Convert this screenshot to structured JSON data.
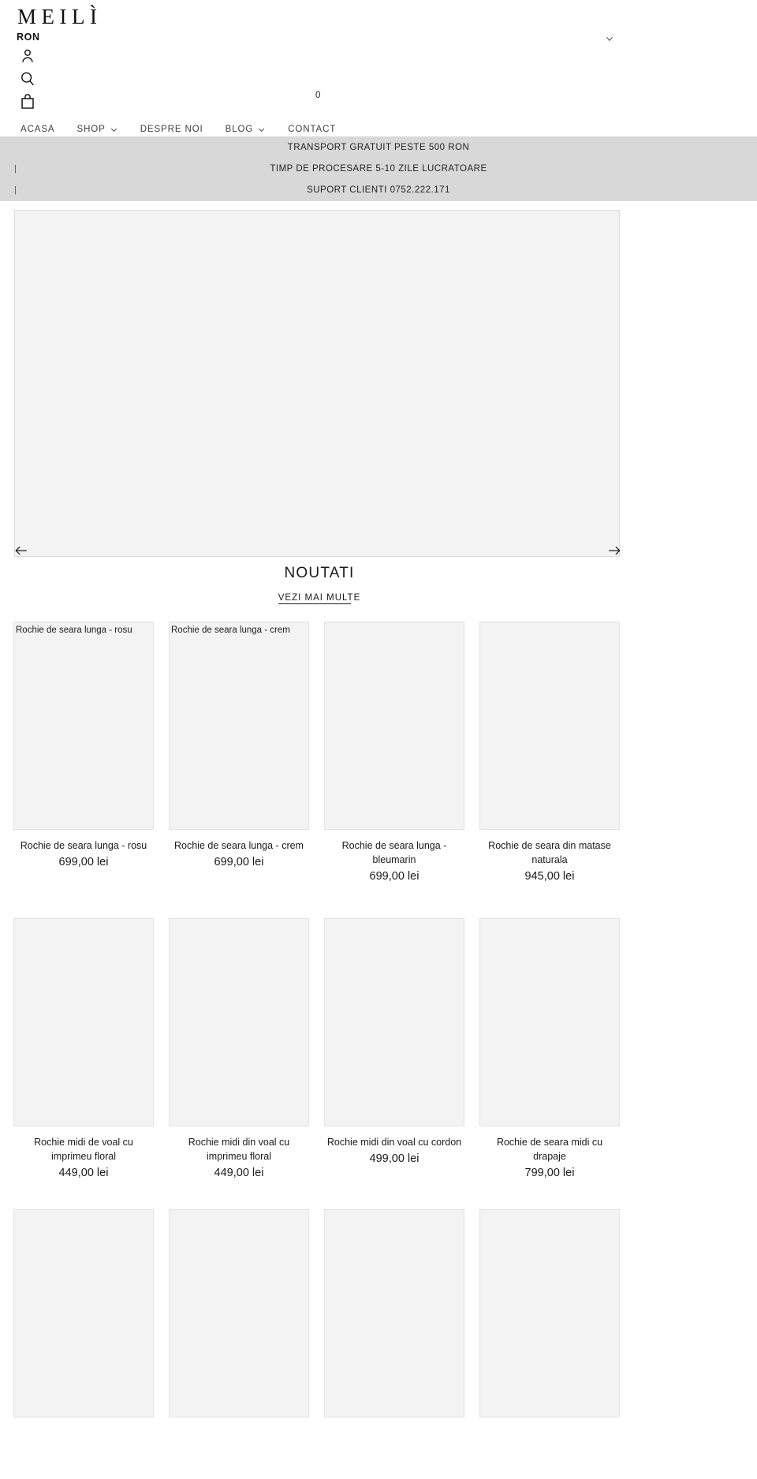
{
  "header": {
    "logo": "MEILÌ",
    "currency": "RON",
    "cart_count": "0",
    "icons": {
      "account": "account-icon",
      "search": "search-icon",
      "bag": "shopping-bag-icon",
      "currency_chevron": "chevron-down-icon"
    }
  },
  "nav": {
    "items": [
      {
        "label": "ACASA",
        "has_dropdown": false
      },
      {
        "label": "SHOP",
        "has_dropdown": true
      },
      {
        "label": "DESPRE NOI",
        "has_dropdown": false
      },
      {
        "label": "BLOG",
        "has_dropdown": true
      },
      {
        "label": "CONTACT",
        "has_dropdown": false
      }
    ]
  },
  "announcement": {
    "rows": [
      {
        "text": "TRANSPORT GRATUIT PESTE 500 RON",
        "pipe": ""
      },
      {
        "text": "TIMP DE PROCESARE 5-10 ZILE LUCRATOARE",
        "pipe": "|"
      },
      {
        "text": "SUPORT CLIENTI 0752.222.171",
        "pipe": "|"
      }
    ],
    "background": "#d8d8d8"
  },
  "hero": {
    "prev_label": "←",
    "next_label": "→",
    "placeholder_color": "#f3f3f3"
  },
  "section": {
    "title": "NOUTATI",
    "link": "VEZI MAI MULTE"
  },
  "products": {
    "row1": [
      {
        "alt": "Rochie de seara lunga - rosu",
        "title": "Rochie de seara lunga - rosu",
        "price": "699,00 lei"
      },
      {
        "alt": "Rochie de seara lunga - crem",
        "title": "Rochie de seara lunga - crem",
        "price": "699,00 lei"
      },
      {
        "alt": "",
        "title": "Rochie de seara lunga - bleumarin",
        "price": "699,00 lei"
      },
      {
        "alt": "",
        "title": "Rochie de seara din matase naturala",
        "price": "945,00 lei"
      }
    ],
    "row2": [
      {
        "alt": "",
        "title": "Rochie midi de voal cu imprimeu floral",
        "price": "449,00 lei"
      },
      {
        "alt": "",
        "title": "Rochie midi din voal cu imprimeu floral",
        "price": "449,00 lei"
      },
      {
        "alt": "",
        "title": "Rochie midi din voal cu cordon",
        "price": "499,00 lei"
      },
      {
        "alt": "",
        "title": "Rochie de seara midi cu drapaje",
        "price": "799,00 lei"
      }
    ],
    "row3": [
      {
        "alt": "",
        "title": "",
        "price": ""
      },
      {
        "alt": "",
        "title": "",
        "price": ""
      },
      {
        "alt": "",
        "title": "",
        "price": ""
      },
      {
        "alt": "",
        "title": "",
        "price": ""
      }
    ]
  }
}
